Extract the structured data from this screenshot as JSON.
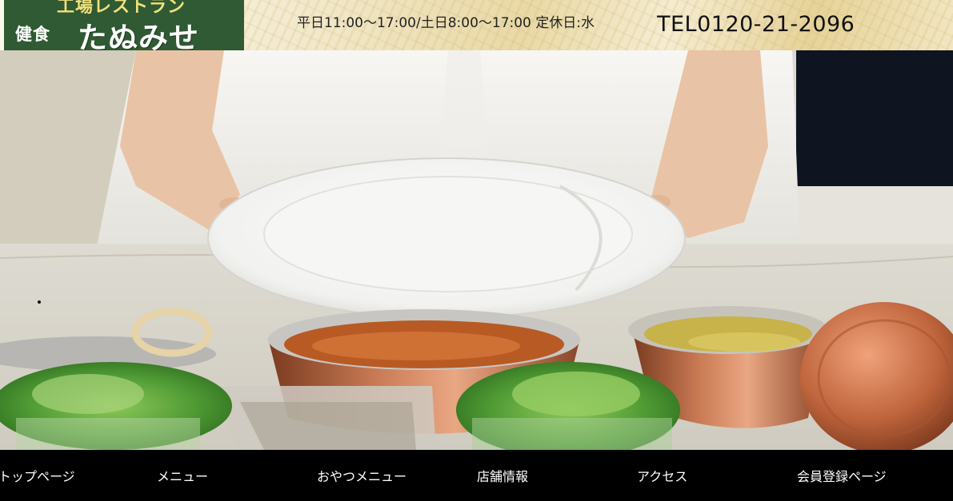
{
  "header": {
    "logo": {
      "top_text": "工場レストラン",
      "small_text": "健食",
      "name": "たぬみせ"
    },
    "hours": "平日11:00～17:00/土日8:00～17:00 定休日:水",
    "tel": "TEL0120-21-2096"
  },
  "hero": {
    "image_subject": "hands-holding-white-plate-above-curry-bowls"
  },
  "nav": {
    "items": [
      {
        "label": "トップページ"
      },
      {
        "label": "メニュー"
      },
      {
        "label": "おやつメニュー"
      },
      {
        "label": "店舗情報"
      },
      {
        "label": "アクセス"
      },
      {
        "label": "会員登録ページ"
      }
    ]
  },
  "colors": {
    "logo_bg": "#2f5a33",
    "logo_accent": "#f3e07a",
    "nav_bg": "#000000",
    "nav_text": "#ffffff"
  }
}
